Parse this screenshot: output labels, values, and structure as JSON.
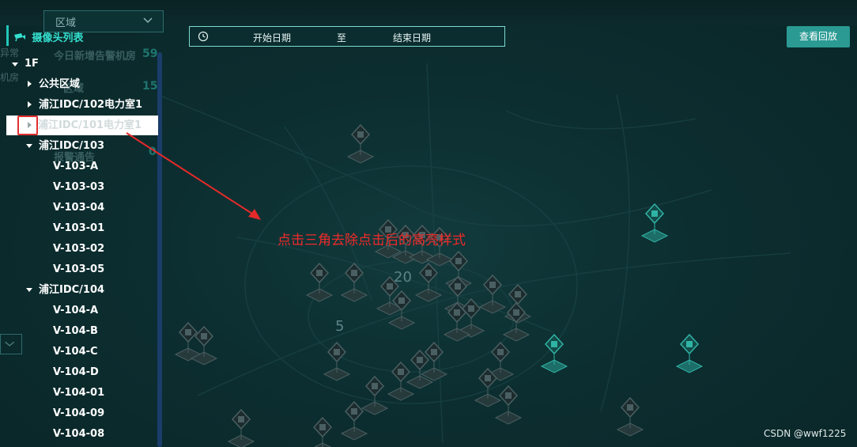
{
  "filters": {
    "region_placeholder": "区域"
  },
  "background_stats": {
    "today_new_label": "今日新增告警机房",
    "today_new_value": "59",
    "area_label": "区域",
    "area_value": "15",
    "alarm_label": "报警通告",
    "alarm_value": "0",
    "abnormal_label": "异常",
    "room_label": "机房"
  },
  "date_range": {
    "start_placeholder": "开始日期",
    "separator": "至",
    "end_placeholder": "结束日期"
  },
  "actions": {
    "view_playback": "查看回放"
  },
  "panel": {
    "title": "摄像头列表"
  },
  "tree": {
    "root": "1F",
    "groups": [
      {
        "label": "公共区域",
        "expanded": false
      },
      {
        "label": "浦江IDC/102电力室1",
        "expanded": false
      },
      {
        "label": "浦江IDC/101电力室1",
        "expanded": false,
        "highlighted": true
      },
      {
        "label": "浦江IDC/103",
        "expanded": true,
        "children": [
          "V-103-A",
          "V-103-03",
          "V-103-04",
          "V-103-01",
          "V-103-02",
          "V-103-05"
        ]
      },
      {
        "label": "浦江IDC/104",
        "expanded": true,
        "children": [
          "V-104-A",
          "V-104-B",
          "V-104-C",
          "V-104-D",
          "V-104-01",
          "V-104-09",
          "V-104-08"
        ]
      }
    ]
  },
  "map": {
    "cluster_labels": [
      "20",
      "5"
    ]
  },
  "annotation": {
    "text": "点击三角去除点击后的高亮样式"
  },
  "watermark": "CSDN @wwf1225",
  "colors": {
    "accent": "#22c8ba",
    "button": "#2a9a93",
    "annotation": "#f02a2a",
    "scrollbar": "#1a3d6a"
  }
}
